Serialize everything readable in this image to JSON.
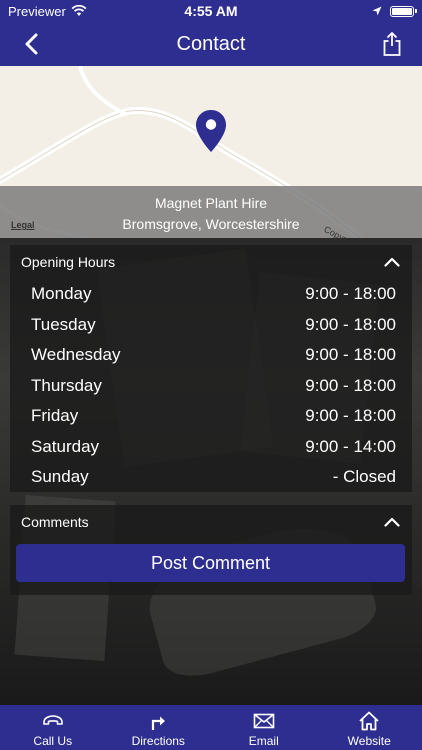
{
  "status": {
    "carrier": "Previewer",
    "time": "4:55 AM",
    "battery_level": 1.0
  },
  "nav": {
    "title": "Contact"
  },
  "map": {
    "business_name": "Magnet Plant Hire",
    "location": "Bromsgrove, Worcestershire",
    "legal_label": "Legal",
    "copyright_label": "Copyr"
  },
  "hours": {
    "section_label": "Opening Hours",
    "days": [
      {
        "day": "Monday",
        "hours": "9:00 - 18:00"
      },
      {
        "day": "Tuesday",
        "hours": "9:00 - 18:00"
      },
      {
        "day": "Wednesday",
        "hours": "9:00 - 18:00"
      },
      {
        "day": "Thursday",
        "hours": "9:00 - 18:00"
      },
      {
        "day": "Friday",
        "hours": "9:00 - 18:00"
      },
      {
        "day": "Saturday",
        "hours": "9:00 - 14:00"
      },
      {
        "day": "Sunday",
        "hours": "- Closed"
      }
    ]
  },
  "comments": {
    "section_label": "Comments",
    "post_button": "Post Comment"
  },
  "tabs": [
    {
      "label": "Call Us",
      "icon": "phone-icon"
    },
    {
      "label": "Directions",
      "icon": "directions-icon"
    },
    {
      "label": "Email",
      "icon": "email-icon"
    },
    {
      "label": "Website",
      "icon": "home-icon"
    }
  ],
  "colors": {
    "brand": "#2e2e90",
    "map_background": "#f3efe6"
  }
}
